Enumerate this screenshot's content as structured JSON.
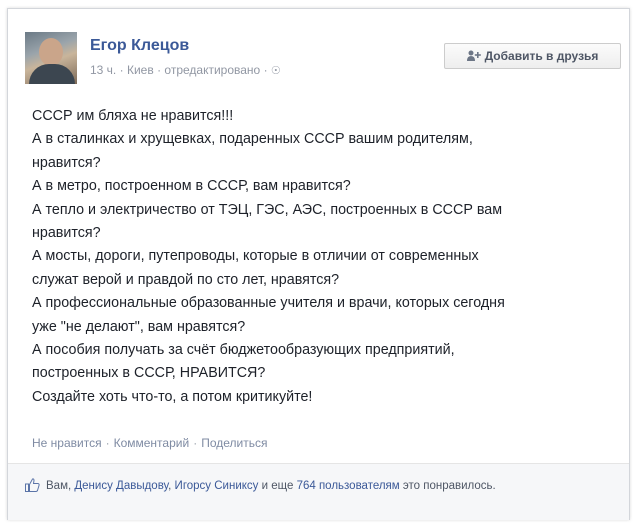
{
  "post": {
    "author": "Егор Клецов",
    "time": "13 ч.",
    "location": "Киев",
    "edited": "отредактировано",
    "add_friend_label": "Добавить в друзья",
    "text_lines": [
      "СССР им бляха не нравится!!!",
      "А в сталинках и хрущевках, подаренных СССР вашим родителям,",
      "нравится?",
      "А в метро, построенном в СССР, вам нравится?",
      "А тепло и электричество от ТЭЦ, ГЭС, АЭС, построенных в СССР вам",
      "нравится?",
      "А мосты, дороги, путепроводы, которые в отличии от современных",
      "служат верой и правдой по сто лет, нравятся?",
      "А профессиональные образованные учителя и врачи, которых сегодня",
      "уже \"не делают\", вам нравятся?",
      "А пособия получать за счёт бюджетообразующих предприятий,",
      "построенных в СССР, НРАВИТСЯ?",
      "Создайте хоть что-то, а потом критикуйте!"
    ]
  },
  "actions": {
    "unlike": "Не нравится",
    "comment": "Комментарий",
    "share": "Поделиться"
  },
  "likes": {
    "you": "Вам",
    "user1": "Денису Давыдову",
    "user2": "Игорсу Синиксу",
    "and_more": "и еще",
    "count": "764",
    "users_link": "пользователям",
    "tail": "это понравилось."
  },
  "colors": {
    "link": "#3b5998",
    "meta": "#9197a3",
    "text": "#1d2129"
  }
}
